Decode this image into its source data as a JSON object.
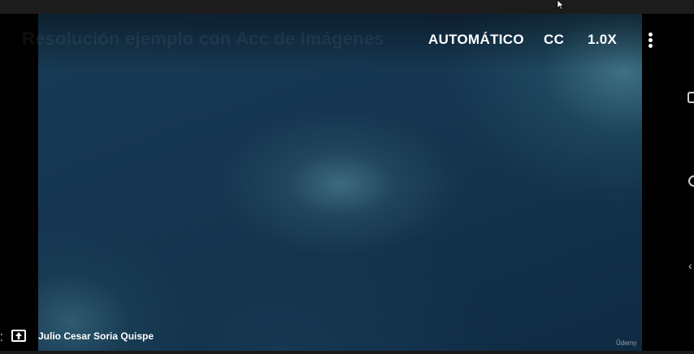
{
  "header": {
    "title": "Resolución ejemplo con Acc de Imágenes"
  },
  "controls": {
    "quality_label": "AUTOMÁTICO",
    "cc_label": "CC",
    "speed_label": "1.0X"
  },
  "footer": {
    "channel_name": "Julio Cesar Soria Quispe",
    "watermark": "Ûdemy",
    "left_edge_glyph": "⁚"
  },
  "colors": {
    "video_background": "#163652",
    "text": "#ffffff"
  },
  "icons": [
    "more-vert-icon",
    "upload-icon",
    "cursor-icon"
  ]
}
